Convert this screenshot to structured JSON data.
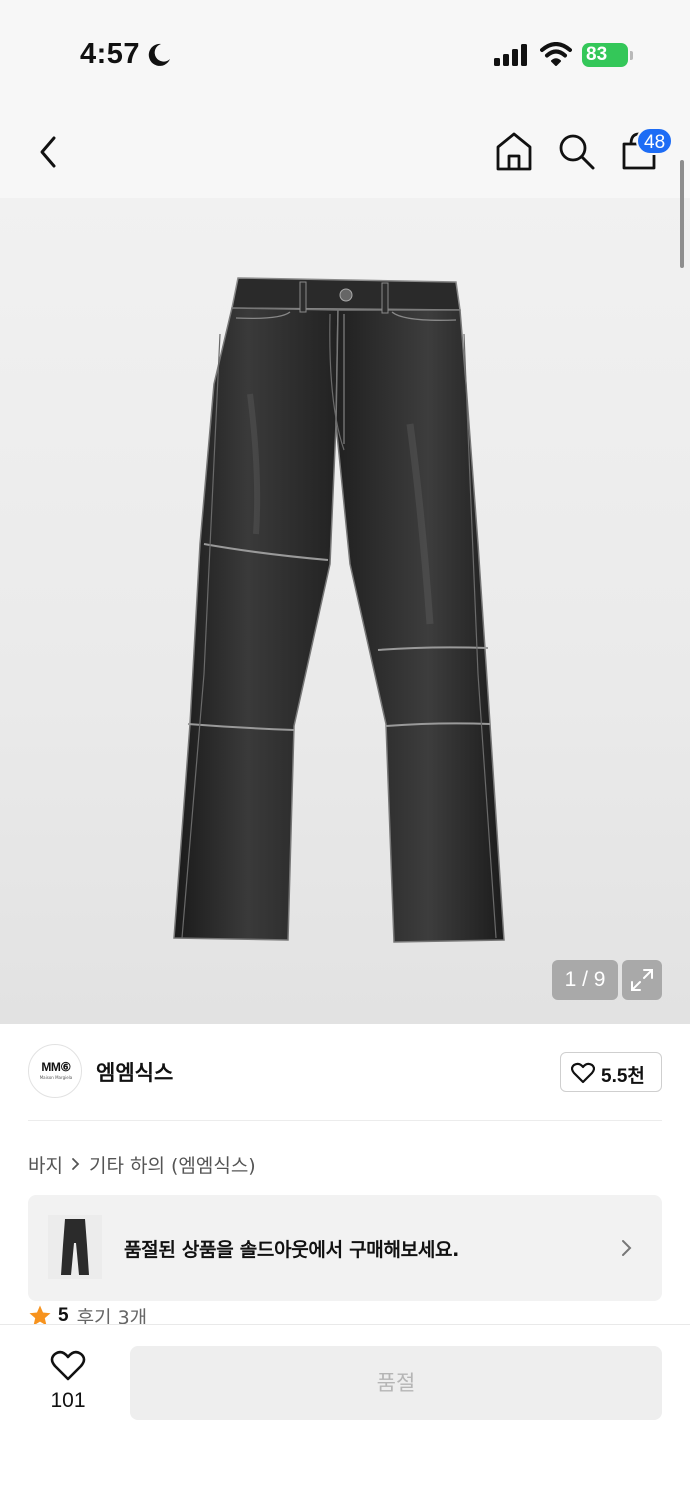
{
  "status": {
    "time": "4:57",
    "battery": "83"
  },
  "nav": {
    "cart_count": "48"
  },
  "gallery": {
    "counter": "1 / 9"
  },
  "brand": {
    "logo_mark": "MM⑥",
    "logo_sub": "Maison Margiela",
    "name": "엠엠식스",
    "like_count": "5.5천"
  },
  "breadcrumb": {
    "level1": "바지",
    "level2": "기타 하의 (엠엠식스)"
  },
  "banner": {
    "text": "품절된 상품을 솔드아웃에서 구매해보세요."
  },
  "rating": {
    "score": "5",
    "reviews": "후기 3개"
  },
  "bottom": {
    "wish_count": "101",
    "buy_label": "품절"
  },
  "colors": {
    "accent_blue": "#1d6cf5",
    "battery_green": "#34c759",
    "star": "#f7931e"
  }
}
